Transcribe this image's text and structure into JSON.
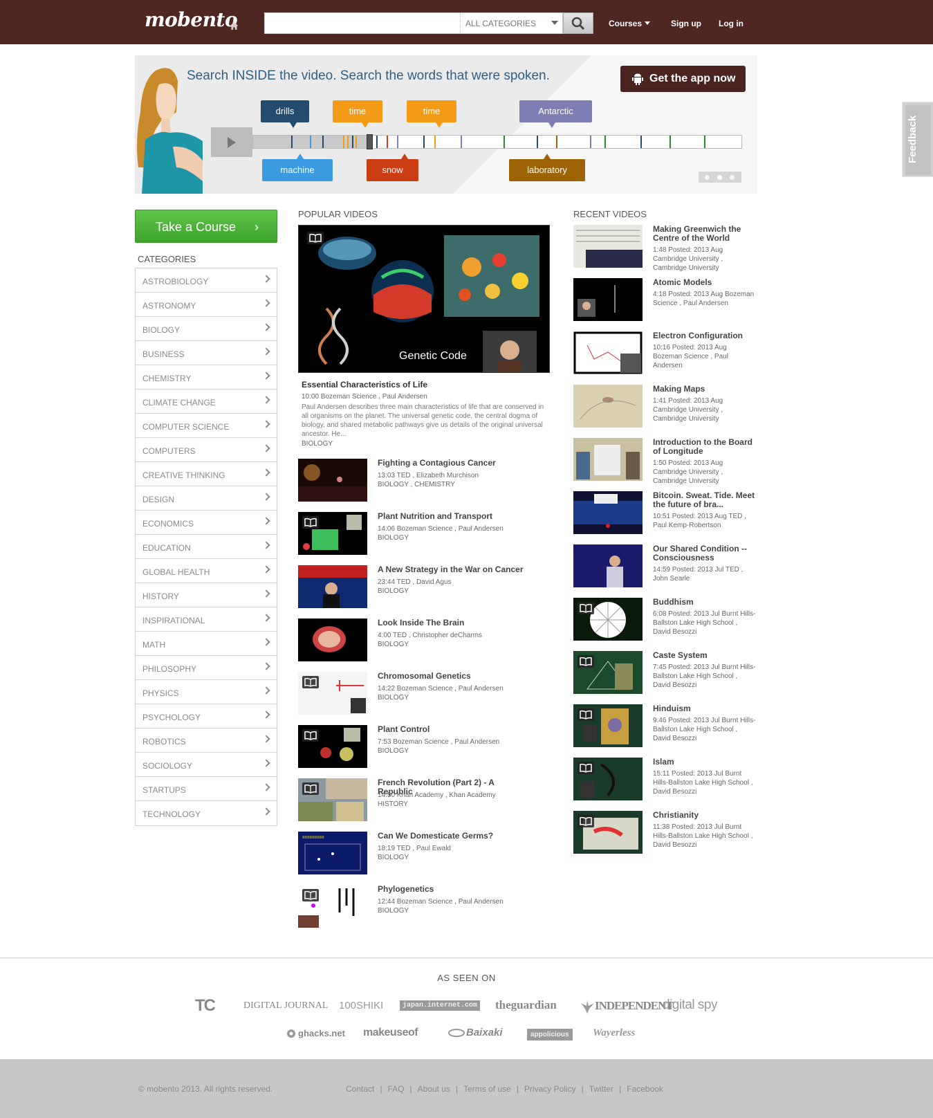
{
  "header": {
    "logo": "mobento",
    "search": {
      "placeholder": "",
      "category": "ALL CATEGORIES"
    },
    "nav": {
      "courses": "Courses",
      "signup": "Sign up",
      "login": "Log in"
    }
  },
  "banner": {
    "headline": "Search INSIDE the video. Search the words that were spoken.",
    "app_button": "Get the app now",
    "tags_top": [
      "drills",
      "time",
      "time",
      "Antarctic"
    ],
    "tags_bottom": [
      "machine",
      "snow",
      "laboratory"
    ],
    "colors": {
      "drills": "#244c6e",
      "time": "#f39a16",
      "antarctic": "#7e7eb5",
      "machine": "#3a9be0",
      "snow": "#cc3d13",
      "laboratory": "#9c6405"
    }
  },
  "feedback": "Feedback",
  "sidebar": {
    "take_course": "Take a Course",
    "categories_heading": "CATEGORIES",
    "categories": [
      "ASTROBIOLOGY",
      "ASTRONOMY",
      "BIOLOGY",
      "BUSINESS",
      "CHEMISTRY",
      "CLIMATE CHANGE",
      "COMPUTER SCIENCE",
      "COMPUTERS",
      "CREATIVE THINKING",
      "DESIGN",
      "ECONOMICS",
      "EDUCATION",
      "GLOBAL HEALTH",
      "HISTORY",
      "INSPIRATIONAL",
      "MATH",
      "PHILOSOPHY",
      "PHYSICS",
      "PSYCHOLOGY",
      "ROBOTICS",
      "SOCIOLOGY",
      "STARTUPS",
      "TECHNOLOGY"
    ]
  },
  "popular": {
    "heading": "POPULAR VIDEOS",
    "featured": {
      "overlay_text": "Genetic Code",
      "title": "Essential Characteristics of Life",
      "meta": "10:00 Bozeman Science , Paul Andersen",
      "description": "Paul Andersen describes three main characteristics of life that are conserved in all organisms on the planet. The universal genetic code, the central dogma of biology, and shared metabolic pathways give us details of the original universal ancestor. He...",
      "category": "BIOLOGY"
    },
    "videos": [
      {
        "title": "Fighting a Contagious Cancer",
        "meta": "13:03 TED , Elizabeth Murchison",
        "cat": "BIOLOGY , CHEMISTRY"
      },
      {
        "title": "Plant Nutrition and Transport",
        "meta": "14:06 Bozeman Science , Paul Andersen",
        "cat": "BIOLOGY"
      },
      {
        "title": "A New Strategy in the War on Cancer",
        "meta": "23:44 TED , David Agus",
        "cat": "BIOLOGY"
      },
      {
        "title": "Look Inside The Brain",
        "meta": "4:00 TED , Christopher deCharms",
        "cat": "BIOLOGY"
      },
      {
        "title": "Chromosomal Genetics",
        "meta": "14:22 Bozeman Science , Paul Andersen",
        "cat": "BIOLOGY"
      },
      {
        "title": "Plant Control",
        "meta": "7:53 Bozeman Science , Paul Andersen",
        "cat": "BIOLOGY"
      },
      {
        "title": "French Revolution (Part 2) - A Republic",
        "meta": "14:50 Khan Academy , Khan Academy",
        "cat": "HISTORY"
      },
      {
        "title": "Can We Domesticate Germs?",
        "meta": "18:19 TED , Paul Ewald",
        "cat": "BIOLOGY"
      },
      {
        "title": "Phylogenetics",
        "meta": "12:44 Bozeman Science , Paul Andersen",
        "cat": "BIOLOGY"
      }
    ]
  },
  "recent": {
    "heading": "RECENT VIDEOS",
    "videos": [
      {
        "title": "Making Greenwich the Centre of the World",
        "meta": "1:48 Posted: 2013 Aug Cambridge University , Cambridge University"
      },
      {
        "title": "Atomic Models",
        "meta": "4:18 Posted: 2013 Aug Bozeman Science , Paul Andersen"
      },
      {
        "title": "Electron Configuration",
        "meta": "10:16 Posted: 2013 Aug Bozeman Science , Paul Andersen"
      },
      {
        "title": "Making Maps",
        "meta": "1:41 Posted: 2013 Aug Cambridge University , Cambridge University"
      },
      {
        "title": "Introduction to the Board of Longitude",
        "meta": "1:50 Posted: 2013 Aug Cambridge University , Cambridge University"
      },
      {
        "title": "Bitcoin. Sweat. Tide. Meet the future of bra...",
        "meta": "10:51 Posted: 2013 Aug TED , Paul Kemp-Robertson"
      },
      {
        "title": "Our Shared Condition -- Consciousness",
        "meta": "14:59 Posted: 2013 Jul TED , John Searle"
      },
      {
        "title": "Buddhism",
        "meta": "6:08 Posted: 2013 Jul Burnt Hills-Ballston Lake High School , David Besozzi"
      },
      {
        "title": "Caste System",
        "meta": "7:45 Posted: 2013 Jul Burnt Hills-Ballston Lake High School , David Besozzi"
      },
      {
        "title": "Hinduism",
        "meta": "9:46 Posted: 2013 Jul Burnt Hills-Ballston Lake High School , David Besozzi"
      },
      {
        "title": "Islam",
        "meta": "15:11 Posted: 2013 Jul Burnt Hills-Ballston Lake High School , David Besozzi"
      },
      {
        "title": "Christianity",
        "meta": "11:38 Posted: 2013 Jul Burnt Hills-Ballston Lake High School , David Besozzi"
      }
    ]
  },
  "as_seen_on": {
    "heading": "AS SEEN ON",
    "row1": [
      "TC",
      "DIGITAL JOURNAL",
      "100SHIKI",
      "japan.internet.com",
      "theguardian",
      "INDEPENDENT",
      "digital spy"
    ],
    "row2": [
      "ghacks.net",
      "makeuseof",
      "Baixaki",
      "appolicious",
      "Wayerless"
    ]
  },
  "footer": {
    "copyright": "© mobento 2013. All rights reserved.",
    "links": [
      "Contact",
      "FAQ",
      "About us",
      "Terms of use",
      "Privacy Policy",
      "Twitter",
      "Facebook"
    ]
  }
}
